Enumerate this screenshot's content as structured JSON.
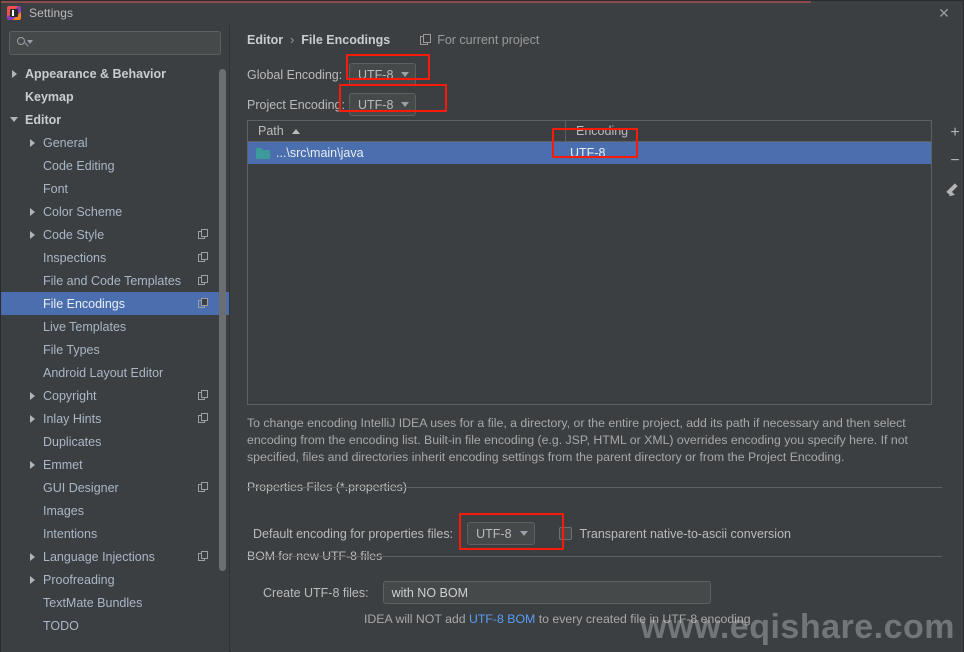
{
  "window": {
    "title": "Settings",
    "app_icon": "intellij-idea-icon",
    "close_label": "✕"
  },
  "sidebar": {
    "search": {
      "value": "",
      "placeholder": "",
      "icon": "search-icon"
    },
    "items": [
      {
        "label": "Appearance & Behavior",
        "indent": 0,
        "arrow": "right",
        "bold": true,
        "badge": false,
        "selected": false
      },
      {
        "label": "Keymap",
        "indent": 0,
        "arrow": "none",
        "bold": true,
        "badge": false,
        "selected": false
      },
      {
        "label": "Editor",
        "indent": 0,
        "arrow": "down",
        "bold": true,
        "badge": false,
        "selected": false
      },
      {
        "label": "General",
        "indent": 1,
        "arrow": "right",
        "bold": false,
        "badge": false,
        "selected": false
      },
      {
        "label": "Code Editing",
        "indent": 1,
        "arrow": "none",
        "bold": false,
        "badge": false,
        "selected": false
      },
      {
        "label": "Font",
        "indent": 1,
        "arrow": "none",
        "bold": false,
        "badge": false,
        "selected": false
      },
      {
        "label": "Color Scheme",
        "indent": 1,
        "arrow": "right",
        "bold": false,
        "badge": false,
        "selected": false
      },
      {
        "label": "Code Style",
        "indent": 1,
        "arrow": "right",
        "bold": false,
        "badge": true,
        "selected": false
      },
      {
        "label": "Inspections",
        "indent": 1,
        "arrow": "none",
        "bold": false,
        "badge": true,
        "selected": false
      },
      {
        "label": "File and Code Templates",
        "indent": 1,
        "arrow": "none",
        "bold": false,
        "badge": true,
        "selected": false
      },
      {
        "label": "File Encodings",
        "indent": 1,
        "arrow": "none",
        "bold": false,
        "badge": true,
        "selected": true
      },
      {
        "label": "Live Templates",
        "indent": 1,
        "arrow": "none",
        "bold": false,
        "badge": false,
        "selected": false
      },
      {
        "label": "File Types",
        "indent": 1,
        "arrow": "none",
        "bold": false,
        "badge": false,
        "selected": false
      },
      {
        "label": "Android Layout Editor",
        "indent": 1,
        "arrow": "none",
        "bold": false,
        "badge": false,
        "selected": false
      },
      {
        "label": "Copyright",
        "indent": 1,
        "arrow": "right",
        "bold": false,
        "badge": true,
        "selected": false
      },
      {
        "label": "Inlay Hints",
        "indent": 1,
        "arrow": "right",
        "bold": false,
        "badge": true,
        "selected": false
      },
      {
        "label": "Duplicates",
        "indent": 1,
        "arrow": "none",
        "bold": false,
        "badge": false,
        "selected": false
      },
      {
        "label": "Emmet",
        "indent": 1,
        "arrow": "right",
        "bold": false,
        "badge": false,
        "selected": false
      },
      {
        "label": "GUI Designer",
        "indent": 1,
        "arrow": "none",
        "bold": false,
        "badge": true,
        "selected": false
      },
      {
        "label": "Images",
        "indent": 1,
        "arrow": "none",
        "bold": false,
        "badge": false,
        "selected": false
      },
      {
        "label": "Intentions",
        "indent": 1,
        "arrow": "none",
        "bold": false,
        "badge": false,
        "selected": false
      },
      {
        "label": "Language Injections",
        "indent": 1,
        "arrow": "right",
        "bold": false,
        "badge": true,
        "selected": false
      },
      {
        "label": "Proofreading",
        "indent": 1,
        "arrow": "right",
        "bold": false,
        "badge": false,
        "selected": false
      },
      {
        "label": "TextMate Bundles",
        "indent": 1,
        "arrow": "none",
        "bold": false,
        "badge": false,
        "selected": false
      },
      {
        "label": "TODO",
        "indent": 1,
        "arrow": "none",
        "bold": false,
        "badge": false,
        "selected": false
      }
    ]
  },
  "breadcrumb": {
    "parent": "Editor",
    "separator": "›",
    "current": "File Encodings",
    "scope_label": "For current project",
    "scope_icon": "copy-scope-icon"
  },
  "encodings": {
    "global_label": "Global Encoding:",
    "global_value": "UTF-8",
    "project_label": "Project Encoding:",
    "project_value": "UTF-8"
  },
  "table": {
    "columns": [
      "Path",
      "Encoding"
    ],
    "sort_column": "Path",
    "sort_direction": "asc",
    "rows": [
      {
        "path": "...\\src\\main\\java",
        "encoding": "UTF-8",
        "icon": "folder-icon",
        "selected": true
      }
    ],
    "tools": [
      {
        "name": "add-button",
        "label": "+"
      },
      {
        "name": "remove-button",
        "label": "−"
      },
      {
        "name": "edit-button",
        "label": ""
      }
    ]
  },
  "description": "To change encoding IntelliJ IDEA uses for a file, a directory, or the entire project, add its path if necessary and then select encoding from the encoding list. Built-in file encoding (e.g. JSP, HTML or XML) overrides encoding you specify here. If not specified, files and directories inherit encoding settings from the parent directory or from the Project Encoding.",
  "properties_group": {
    "title": "Properties Files (*.properties)",
    "default_encoding_label": "Default encoding for properties files:",
    "default_encoding_value": "UTF-8",
    "transparent_label": "Transparent native-to-ascii conversion",
    "transparent_checked": false
  },
  "bom_group": {
    "title": "BOM for new UTF-8 files",
    "create_label": "Create UTF-8 files:",
    "create_value": "with NO BOM",
    "hint_prefix": "IDEA will NOT add ",
    "hint_link": "UTF-8 BOM",
    "hint_suffix": " to every created file in UTF-8 encoding"
  },
  "watermark": "www.eqishare.com",
  "colors": {
    "background": "#3c3f41",
    "selection": "#4b6eaf",
    "highlight_box": "#f81b0a",
    "link": "#589df6",
    "folder": "#3c9a9a",
    "text": "#bbbbbb"
  }
}
